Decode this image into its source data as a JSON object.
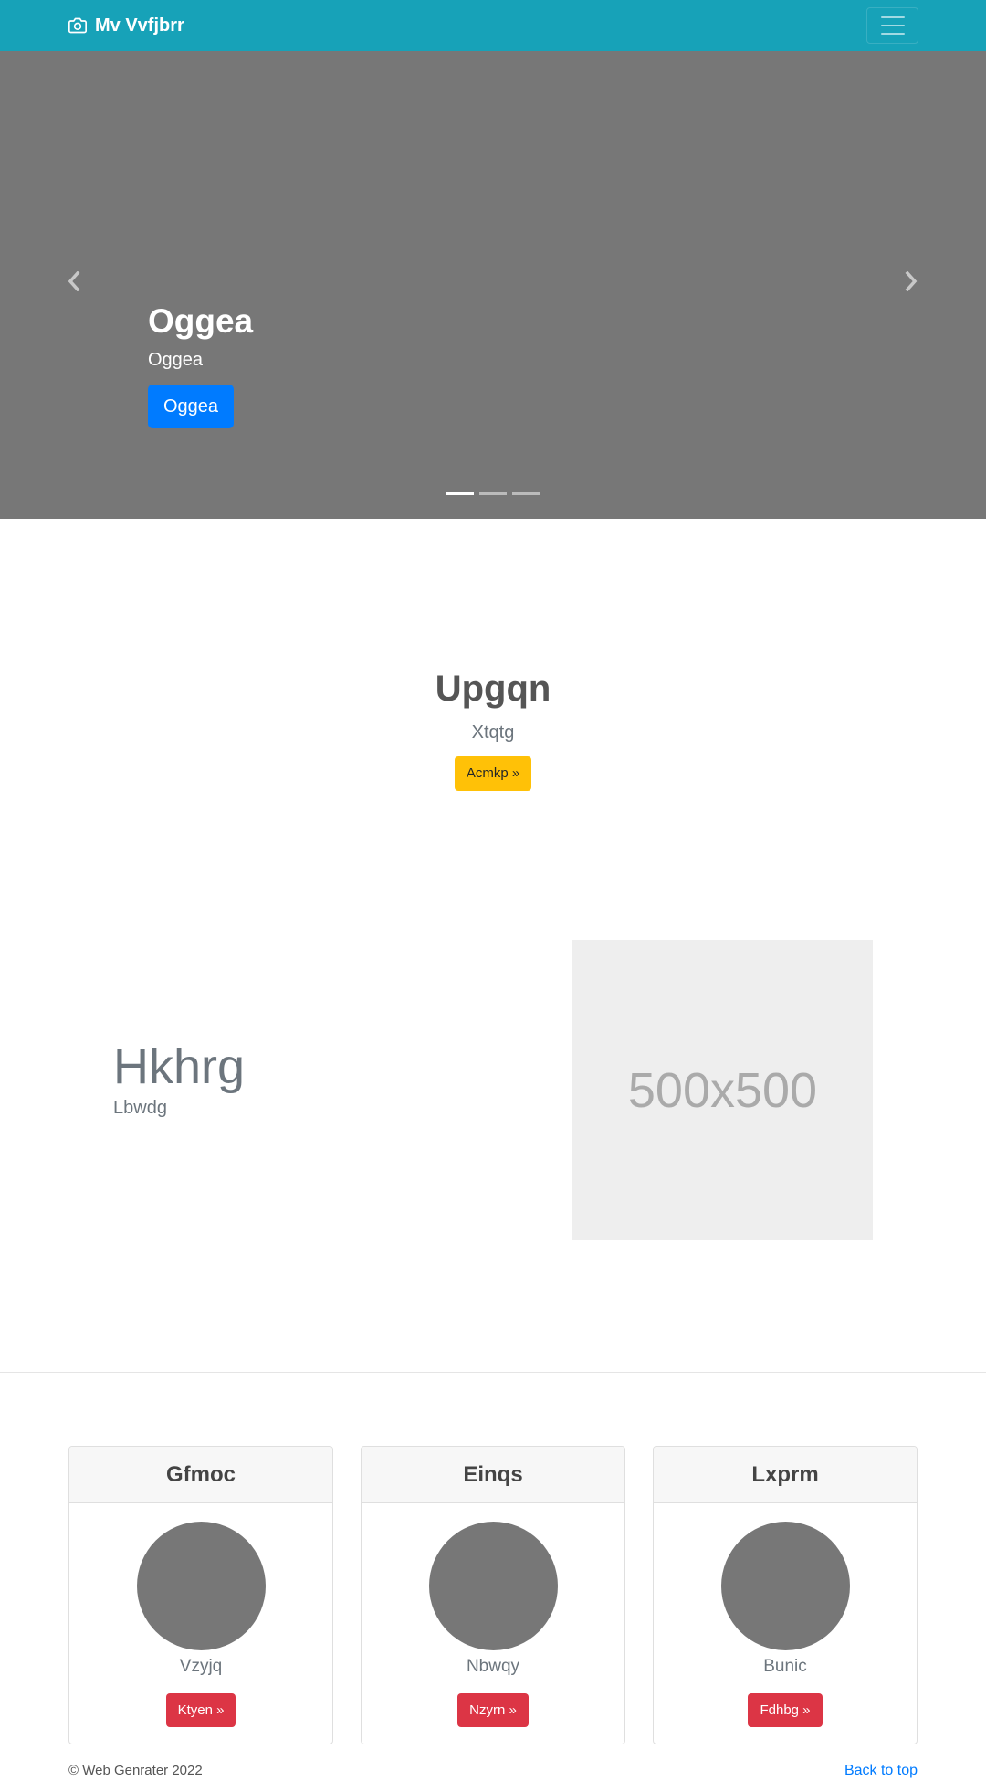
{
  "navbar": {
    "brand": "Mv Vvfjbrr",
    "brand_icon": "camera-icon",
    "toggler_icon": "hamburger-menu-icon",
    "background": "#17a2b8"
  },
  "carousel": {
    "title": "Oggea",
    "subtitle": "Oggea",
    "button_label": "Oggea",
    "prev_icon": "chevron-left-icon",
    "next_icon": "chevron-right-icon",
    "slides_count": 3,
    "active_slide": 1
  },
  "jumbotron": {
    "title": "Upgqn",
    "subtitle": "Xtqtg",
    "button_label": "Acmkp »"
  },
  "feature": {
    "title": "Hkhrg",
    "subtitle": "Lbwdg",
    "image_placeholder": "500x500"
  },
  "cards": [
    {
      "header": "Gfmoc",
      "text": "Vzyjq",
      "button_label": "Ktyen »"
    },
    {
      "header": "Einqs",
      "text": "Nbwqy",
      "button_label": "Nzyrn »"
    },
    {
      "header": "Lxprm",
      "text": "Bunic",
      "button_label": "Fdhbg »"
    }
  ],
  "footer": {
    "copyright": "© Web Genrater 2022",
    "back_to_top": "Back to top"
  },
  "colors": {
    "primary": "#007bff",
    "warning": "#ffc107",
    "danger": "#dc3545",
    "info": "#17a2b8"
  }
}
